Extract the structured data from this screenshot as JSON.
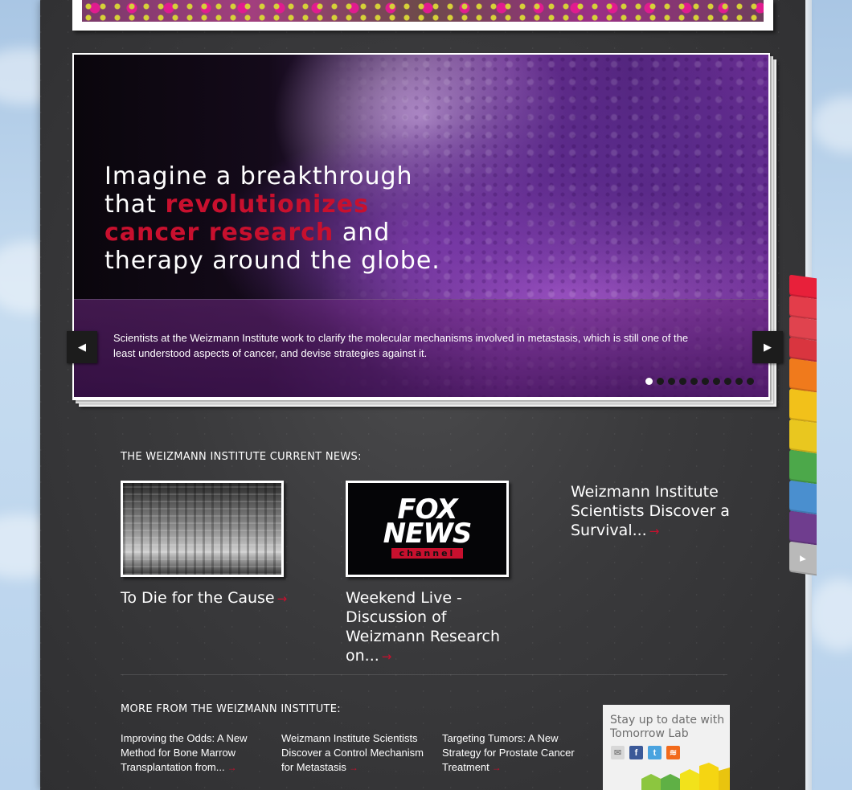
{
  "hero": {
    "headline_1": "Imagine a breakthrough",
    "headline_2a": "that ",
    "headline_2b": "revolutionizes",
    "headline_3a": "cancer research",
    "headline_3b": " and",
    "headline_4": "therapy around the globe.",
    "caption": "Scientists at the Weizmann Institute work to clarify the molecular mechanisms involved in metastasis, which is still one of the least understood aspects of cancer, and devise strategies against it.",
    "slide_count": 10,
    "active_slide": 1
  },
  "news": {
    "title": "THE WEIZMANN INSTITUTE CURRENT NEWS:",
    "items": [
      {
        "title": "To Die for the Cause"
      },
      {
        "title": "Weekend Live - Discussion of Weizmann Research on...",
        "thumb_text_1": "FOX",
        "thumb_text_2": "NEWS",
        "thumb_text_3": "channel"
      },
      {
        "title": "Weizmann Institute Scientists Discover a Survival..."
      }
    ]
  },
  "more": {
    "title": "MORE FROM THE WEIZMANN INSTITUTE:",
    "items": [
      {
        "title": "Improving the Odds: A New Method for Bone Marrow Transplantation from..."
      },
      {
        "title": "Weizmann Institute Scientists Discover a Control Mechanism for Metastasis"
      },
      {
        "title": "Targeting Tumors: A New Strategy for Prostate Cancer Treatment"
      }
    ]
  },
  "lab": {
    "text": "Stay up to date with Tomorrow Lab",
    "icons": [
      "mail-icon",
      "facebook-icon",
      "twitter-icon",
      "rss-icon"
    ]
  },
  "side_tabs": {
    "colors": [
      "#e8203a",
      "#e33d4a",
      "#e0434e",
      "#d9353f",
      "#f07a1c",
      "#f2c11a",
      "#e9c71f",
      "#4ca84a",
      "#4a8fcf",
      "#6f3d8e",
      "#b9b9b9"
    ]
  },
  "colors": {
    "accent_red": "#c8102e"
  }
}
